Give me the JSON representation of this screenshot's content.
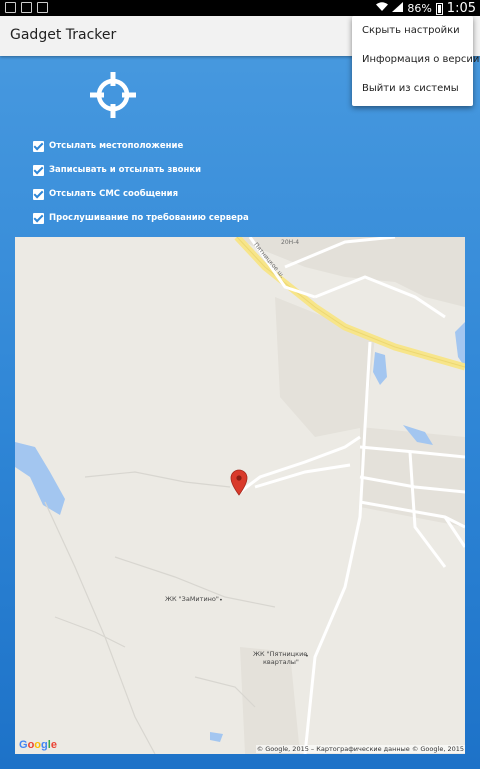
{
  "status_bar": {
    "battery": "86%",
    "time": "1:05"
  },
  "app": {
    "title": "Gadget Tracker"
  },
  "menu": {
    "items": [
      "Скрыть настройки",
      "Информация о версии",
      "Выйти из системы"
    ]
  },
  "settings": {
    "checkboxes": [
      {
        "label": "Отсылать местоположение",
        "checked": true
      },
      {
        "label": "Записывать и отсылать звонки",
        "checked": true
      },
      {
        "label": "Отсылать СМС сообщения",
        "checked": true
      },
      {
        "label": "Прослушивание по требованию сервера",
        "checked": true
      }
    ]
  },
  "map": {
    "labels": {
      "place1": "ЖК \"ЗаМитино\"",
      "place2_line1": "ЖК \"Пятницкие",
      "place2_line2": "кварталы\"",
      "road1": "Пятницкое ш.",
      "road2": "20Н-4"
    },
    "logo": "Google",
    "attribution": "© Google, 2015 – Картографические данные © Google, 2015"
  },
  "colors": {
    "accent": "#2f86d6",
    "appbar": "#f2f2f2",
    "map_bg": "#eceae4",
    "water": "#a3c6f0",
    "highway": "#f7e58a",
    "pin": "#d93a2b"
  }
}
